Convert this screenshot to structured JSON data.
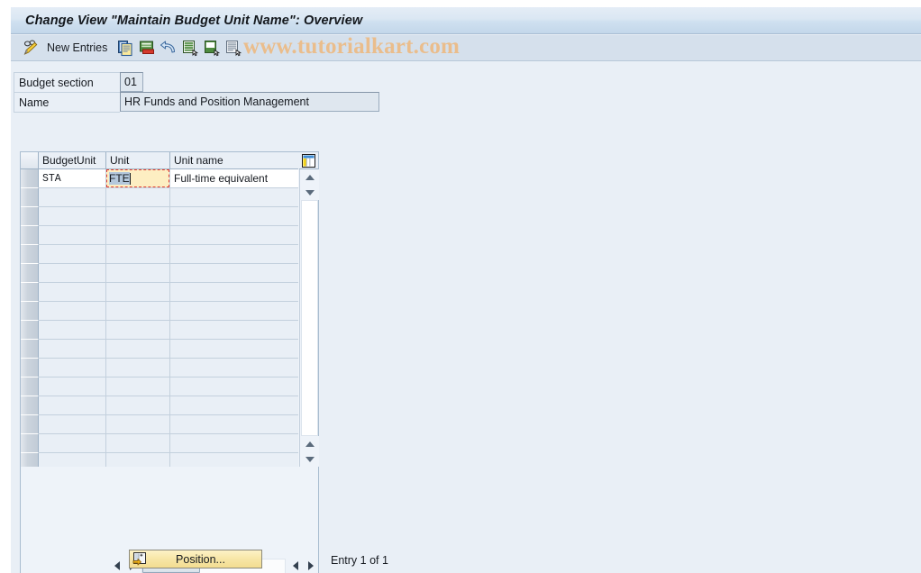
{
  "window": {
    "title": "Change View \"Maintain Budget Unit Name\": Overview"
  },
  "toolbar": {
    "display_change_icon": "pencil-glasses-icon",
    "new_entries_label": "New Entries",
    "icons": [
      {
        "name": "copy-icon",
        "title": "Copy As..."
      },
      {
        "name": "delete-icon",
        "title": "Delete"
      },
      {
        "name": "undo-icon",
        "title": "Undo Change"
      },
      {
        "name": "select-all-icon",
        "title": "Select All"
      },
      {
        "name": "deselect-all-icon",
        "title": "Deselect All"
      },
      {
        "name": "select-block-icon",
        "title": "Select Block"
      }
    ]
  },
  "watermark": {
    "text": "www.tutorialkart.com",
    "color": "#eabd8c"
  },
  "form": {
    "fields": [
      {
        "label": "Budget section",
        "value": "01"
      },
      {
        "label": "Name",
        "value": "HR Funds and Position Management"
      }
    ]
  },
  "table": {
    "config_icon": "table-settings-icon",
    "columns": [
      "BudgetUnit",
      "Unit",
      "Unit name"
    ],
    "rows": [
      {
        "budget_unit": "STA",
        "unit": "FTE",
        "unit_name": "Full-time equivalent",
        "focused": true
      },
      {
        "budget_unit": "",
        "unit": "",
        "unit_name": ""
      },
      {
        "budget_unit": "",
        "unit": "",
        "unit_name": ""
      },
      {
        "budget_unit": "",
        "unit": "",
        "unit_name": ""
      },
      {
        "budget_unit": "",
        "unit": "",
        "unit_name": ""
      },
      {
        "budget_unit": "",
        "unit": "",
        "unit_name": ""
      },
      {
        "budget_unit": "",
        "unit": "",
        "unit_name": ""
      },
      {
        "budget_unit": "",
        "unit": "",
        "unit_name": ""
      },
      {
        "budget_unit": "",
        "unit": "",
        "unit_name": ""
      },
      {
        "budget_unit": "",
        "unit": "",
        "unit_name": ""
      },
      {
        "budget_unit": "",
        "unit": "",
        "unit_name": ""
      },
      {
        "budget_unit": "",
        "unit": "",
        "unit_name": ""
      },
      {
        "budget_unit": "",
        "unit": "",
        "unit_name": ""
      },
      {
        "budget_unit": "",
        "unit": "",
        "unit_name": ""
      },
      {
        "budget_unit": "",
        "unit": "",
        "unit_name": ""
      },
      {
        "budget_unit": "",
        "unit": "",
        "unit_name": ""
      }
    ],
    "focused_cell": {
      "selected_text": "FTE",
      "focus_border_color": "#e23a2e",
      "background_color": "#fdeec2"
    }
  },
  "footer": {
    "position_button_label": "Position...",
    "position_button_icon": "position-icon",
    "entry_status": "Entry 1 of 1"
  },
  "colors": {
    "page_background": "#e9eff6",
    "titlebar_gradient_top": "#e4edf6",
    "titlebar_gradient_bottom": "#c3d7ea",
    "toolbar_background": "#d5e0ec",
    "table_border": "#a9bdd0",
    "button_yellow": "#f7e6a6"
  }
}
